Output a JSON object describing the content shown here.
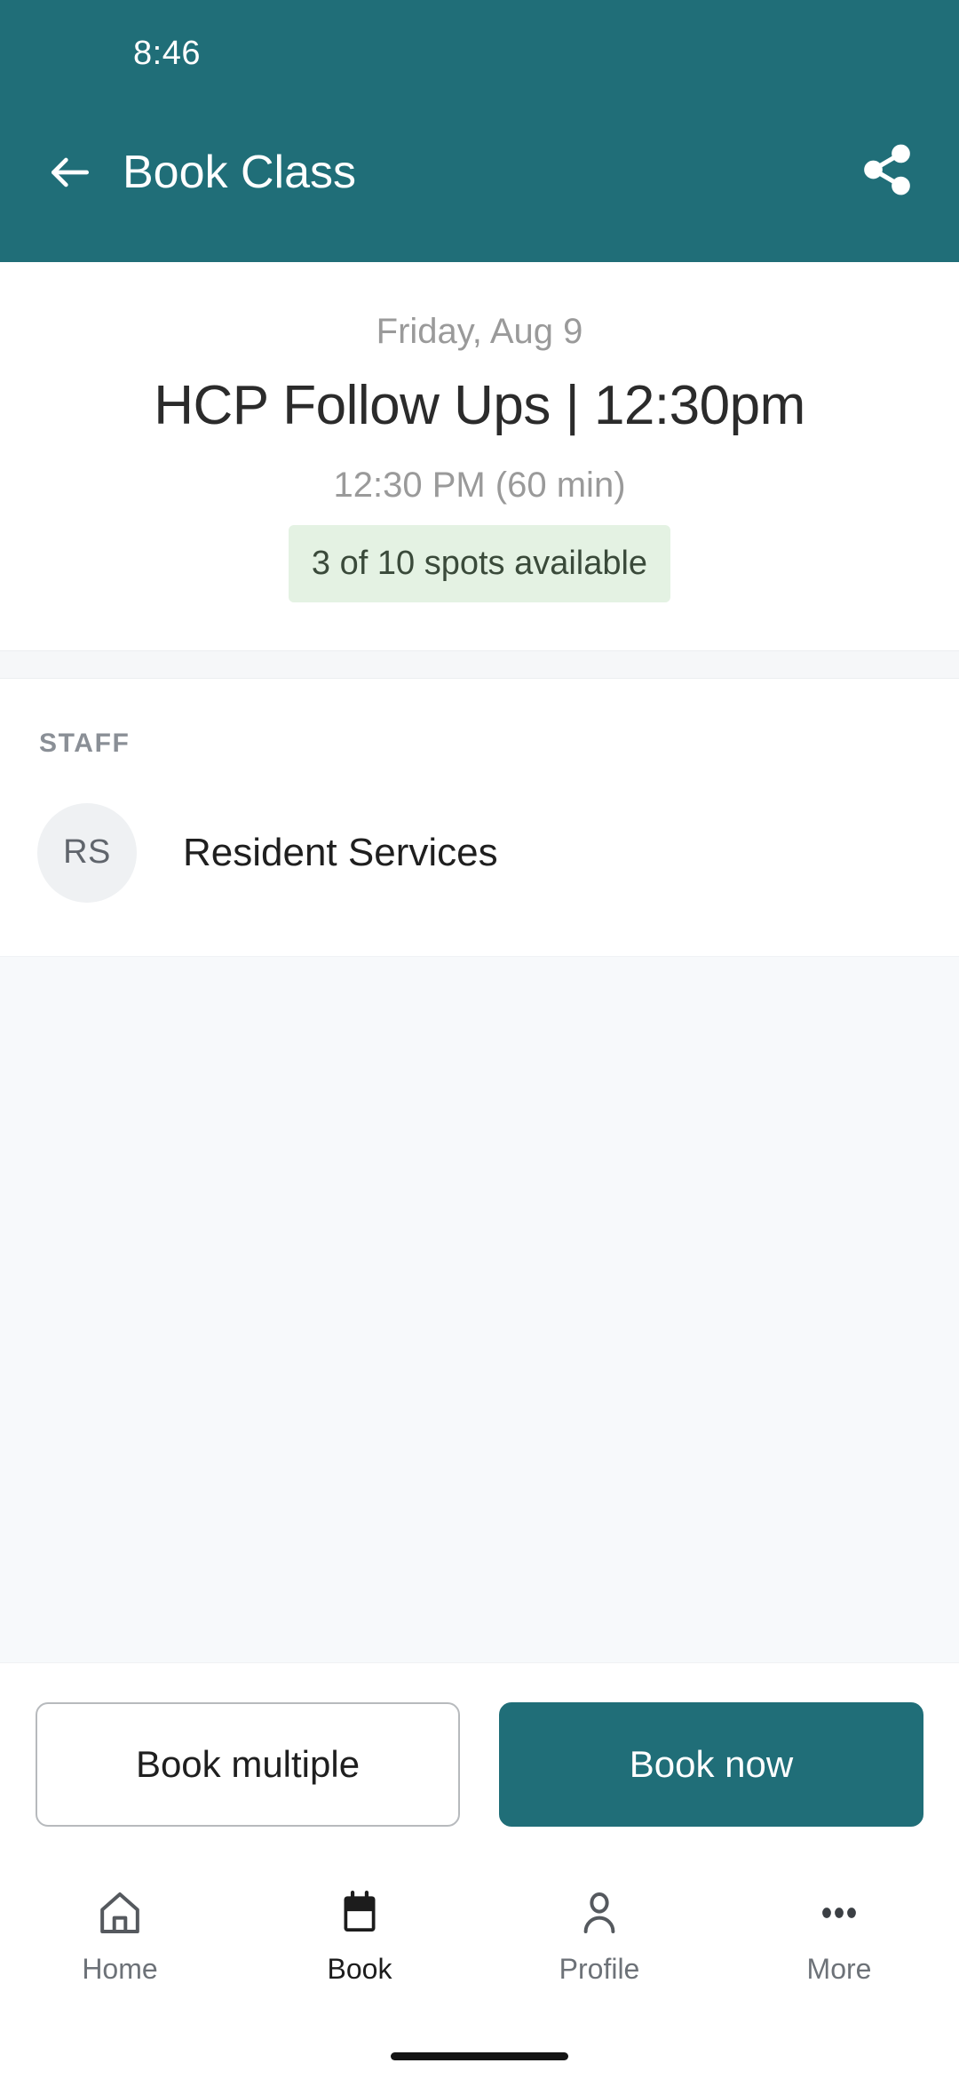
{
  "status_bar": {
    "clock": "8:46"
  },
  "app_bar": {
    "title": "Book Class",
    "back_icon": "arrow-left-icon",
    "share_icon": "share-icon"
  },
  "hero": {
    "date": "Friday, Aug 9",
    "title": "HCP Follow Ups | 12:30pm",
    "time_duration": "12:30 PM (60 min)",
    "spots_badge": "3 of 10 spots available"
  },
  "staff_section": {
    "label": "STAFF",
    "members": [
      {
        "initials": "RS",
        "name": "Resident Services"
      }
    ]
  },
  "actions": {
    "secondary_label": "Book multiple",
    "primary_label": "Book now"
  },
  "bottom_nav": {
    "items": [
      {
        "label": "Home",
        "icon": "home-icon",
        "active": false
      },
      {
        "label": "Book",
        "icon": "calendar-icon",
        "active": true
      },
      {
        "label": "Profile",
        "icon": "person-icon",
        "active": false
      },
      {
        "label": "More",
        "icon": "more-dots-icon",
        "active": false
      }
    ]
  },
  "colors": {
    "brand_teal": "#206E78",
    "badge_green_bg": "#E4F2E3",
    "page_gray": "#F7F9FB",
    "muted_text": "#9a9a9a"
  }
}
